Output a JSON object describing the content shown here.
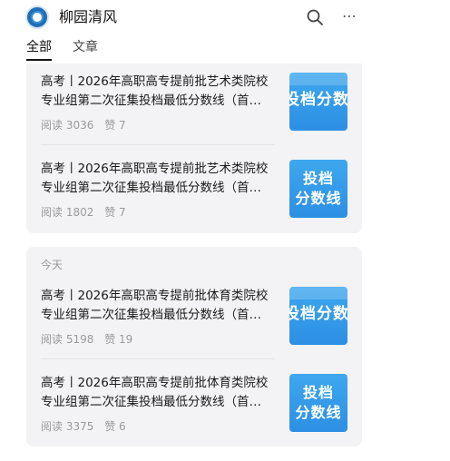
{
  "header": {
    "title": "柳园清风",
    "search_icon": "search-icon",
    "more_icon": "more-icon",
    "more_glyph": "⋯"
  },
  "tabs": [
    {
      "label": "全部",
      "active": true
    },
    {
      "label": "文章",
      "active": false
    }
  ],
  "groups": [
    {
      "day_label": "",
      "articles": [
        {
          "title": "高考丨2026年高职高专提前批艺术类院校专业组第二次征集投档最低分数线（首…",
          "reads": "阅读 3036",
          "likes": "赞 7",
          "thumb_text": "投档分数线"
        },
        {
          "title": "高考丨2026年高职高专提前批艺术类院校专业组第二次征集投档最低分数线（首…",
          "reads": "阅读 1802",
          "likes": "赞 7",
          "thumb_line1": "投档",
          "thumb_line2": "分数线"
        }
      ]
    },
    {
      "day_label": "今天",
      "articles": [
        {
          "title": "高考丨2026年高职高专提前批体育类院校专业组第二次征集投档最低分数线（首…",
          "reads": "阅读 5198",
          "likes": "赞 19",
          "thumb_text": "投档分数线"
        },
        {
          "title": "高考丨2026年高职高专提前批体育类院校专业组第二次征集投档最低分数线（首…",
          "reads": "阅读 3375",
          "likes": "赞 6",
          "thumb_line1": "投档",
          "thumb_line2": "分数线"
        }
      ]
    }
  ],
  "colors": {
    "card_bg": "#f3f3f5",
    "thumb_blue": "#2d8fe3",
    "meta_gray": "#9a9a9a"
  }
}
